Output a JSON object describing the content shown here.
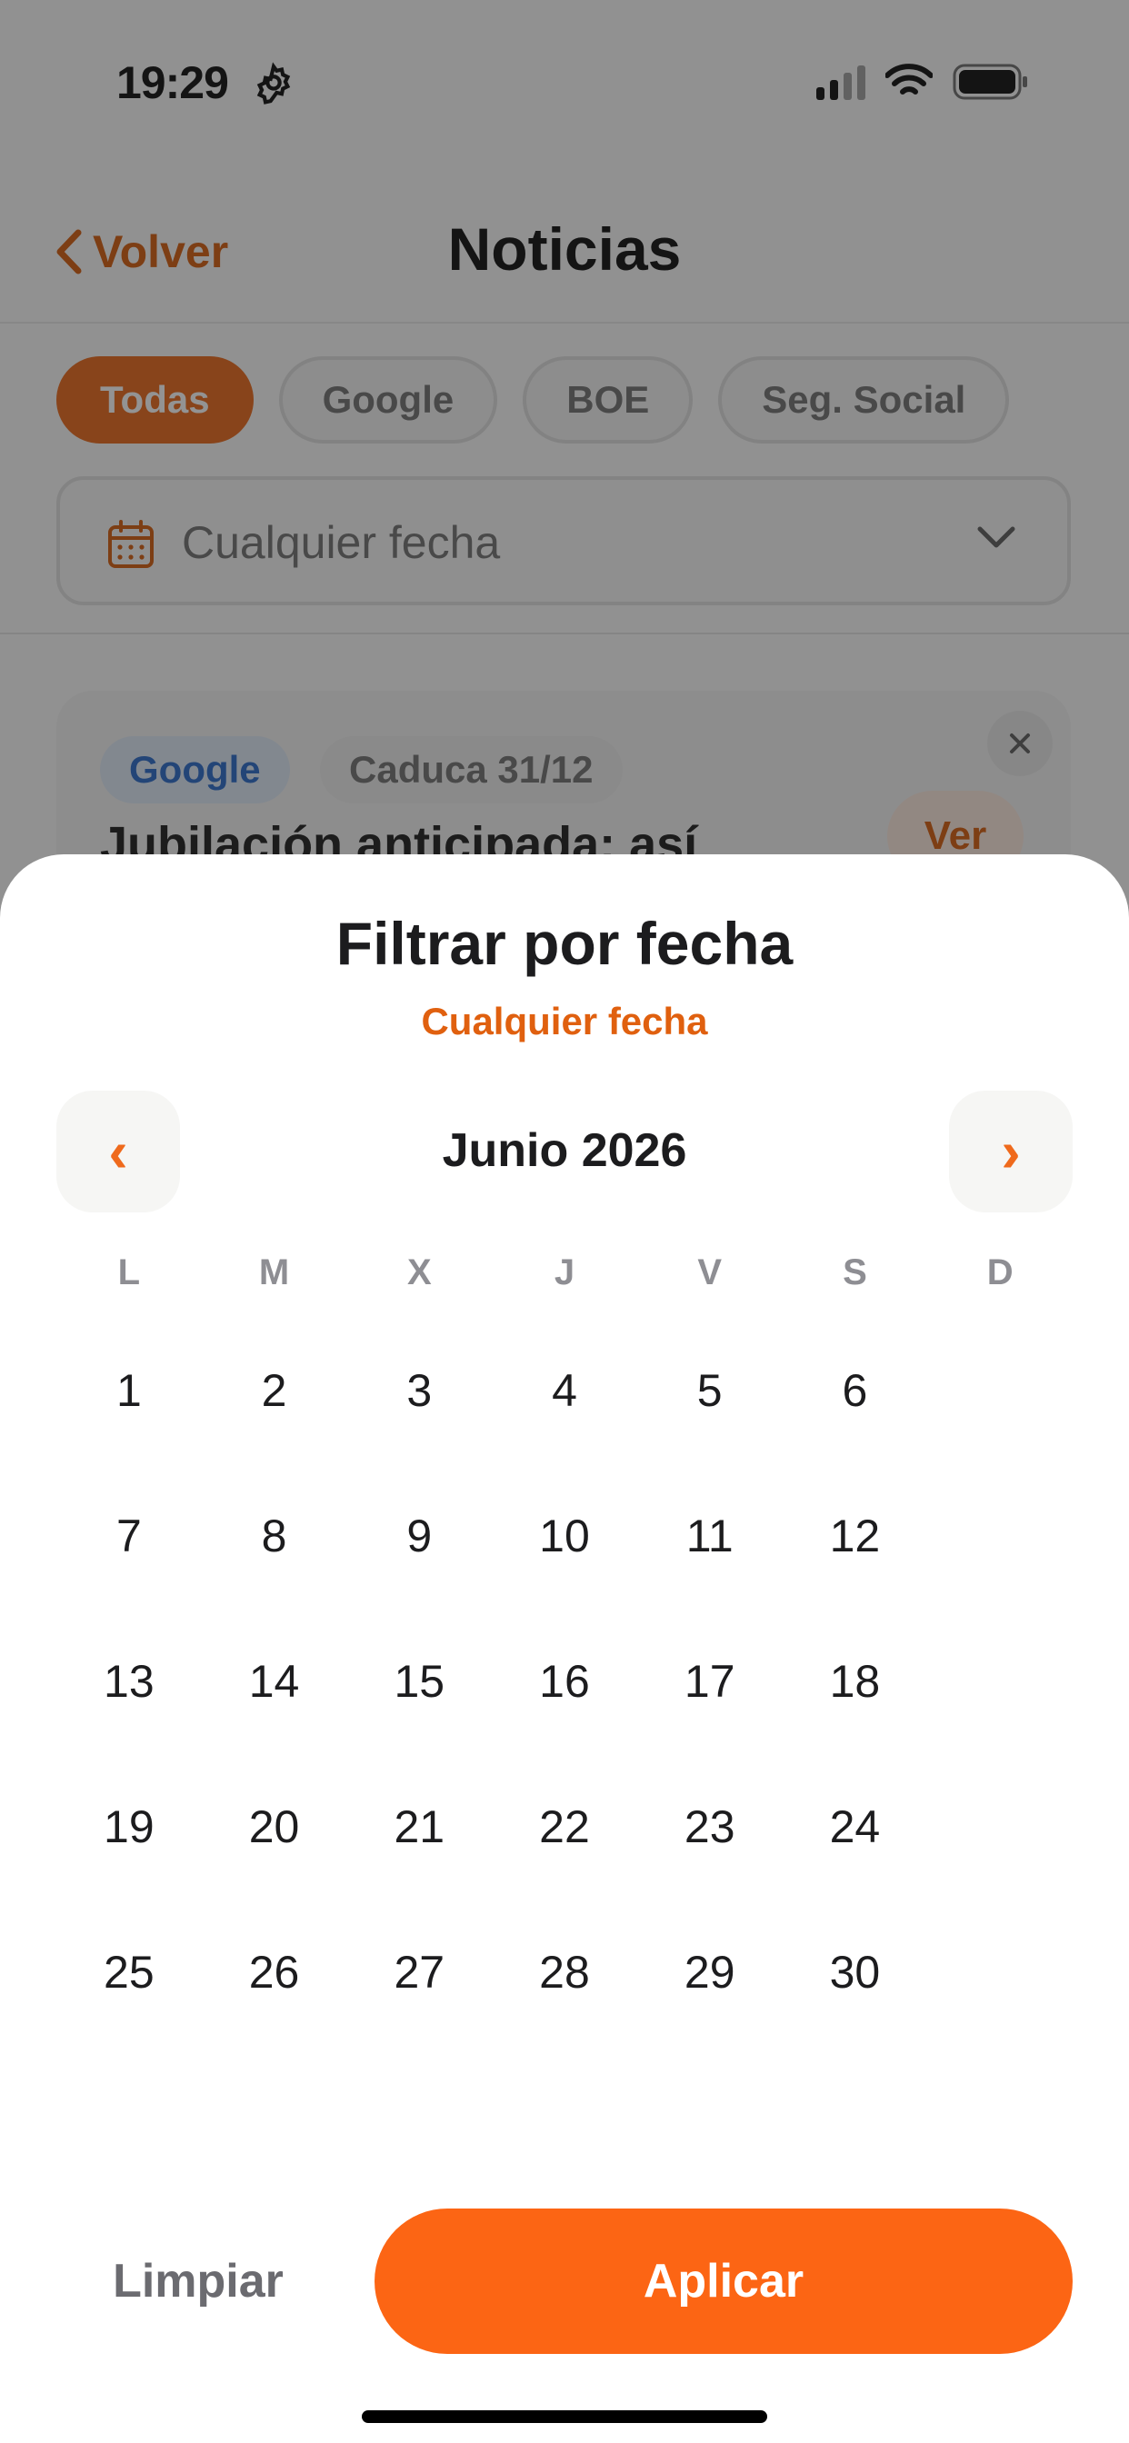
{
  "status": {
    "time": "19:29"
  },
  "nav": {
    "back_label": "Volver",
    "title": "Noticias"
  },
  "filters": {
    "chips": [
      {
        "label": "Todas",
        "active": true
      },
      {
        "label": "Google",
        "active": false
      },
      {
        "label": "BOE",
        "active": false
      },
      {
        "label": "Seg. Social",
        "active": false
      }
    ],
    "date_select": "Cualquier fecha"
  },
  "card": {
    "source_badge": "Google",
    "expiry_badge": "Caduca 31/12",
    "title": "Jubilación anticipada: así",
    "action": "Ver"
  },
  "sheet": {
    "title": "Filtrar por fecha",
    "subtitle": "Cualquier fecha",
    "prev_icon": "‹",
    "next_icon": "›",
    "month": "Junio 2026",
    "weekdays": [
      "L",
      "M",
      "X",
      "J",
      "V",
      "S",
      "D"
    ],
    "days": [
      "1",
      "2",
      "3",
      "4",
      "5",
      "6",
      "",
      "7",
      "8",
      "9",
      "10",
      "11",
      "12",
      "",
      "13",
      "14",
      "15",
      "16",
      "17",
      "18",
      "",
      "19",
      "20",
      "21",
      "22",
      "23",
      "24",
      "",
      "25",
      "26",
      "27",
      "28",
      "29",
      "30",
      ""
    ],
    "clear_label": "Limpiar",
    "apply_label": "Aplicar"
  },
  "colors": {
    "accent": "#fc6514",
    "accent_text": "#e0600f",
    "dim_overlay": "rgba(40,40,40,0.5)"
  },
  "icons": [
    "gear-icon",
    "signal-icon",
    "wifi-icon",
    "battery-icon",
    "chevron-left-icon",
    "calendar-icon",
    "chevron-down-icon",
    "close-icon"
  ]
}
